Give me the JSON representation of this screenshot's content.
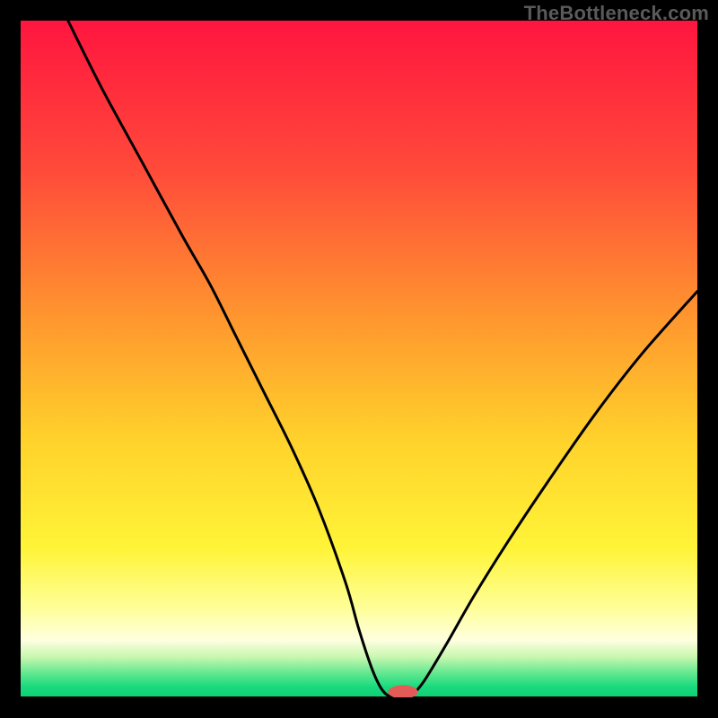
{
  "watermark": "TheBottleneck.com",
  "chart_data": {
    "type": "line",
    "title": "",
    "xlabel": "",
    "ylabel": "",
    "xlim": [
      0,
      100
    ],
    "ylim": [
      0,
      100
    ],
    "grid": false,
    "gradient_stops": [
      {
        "offset": 0,
        "color": "#ff153f"
      },
      {
        "offset": 0.22,
        "color": "#ff4a3a"
      },
      {
        "offset": 0.45,
        "color": "#ff9a2e"
      },
      {
        "offset": 0.62,
        "color": "#ffd22b"
      },
      {
        "offset": 0.78,
        "color": "#fff438"
      },
      {
        "offset": 0.87,
        "color": "#feff9a"
      },
      {
        "offset": 0.915,
        "color": "#ffffe0"
      },
      {
        "offset": 0.94,
        "color": "#c9f7b0"
      },
      {
        "offset": 0.965,
        "color": "#5fe78f"
      },
      {
        "offset": 0.985,
        "color": "#18d97d"
      },
      {
        "offset": 1.0,
        "color": "#0fcf76"
      }
    ],
    "series": [
      {
        "name": "bottleneck-curve",
        "color": "#000000",
        "x": [
          7,
          12,
          18,
          24,
          28,
          32,
          36,
          40,
          44,
          48,
          50,
          52,
          53.5,
          55,
          57,
          58.5,
          60,
          63,
          67,
          72,
          78,
          85,
          92,
          100
        ],
        "y": [
          100,
          90,
          79,
          68,
          61,
          53,
          45,
          37,
          28,
          17,
          10,
          4,
          1,
          0,
          0,
          1,
          3,
          8,
          15,
          23,
          32,
          42,
          51,
          60
        ]
      }
    ],
    "marker": {
      "x": 56.5,
      "y": 0.8,
      "rx": 2.2,
      "ry": 1.0,
      "color": "#e35b57"
    },
    "baseline": {
      "y": 0,
      "color": "#000000",
      "width": 2
    }
  }
}
